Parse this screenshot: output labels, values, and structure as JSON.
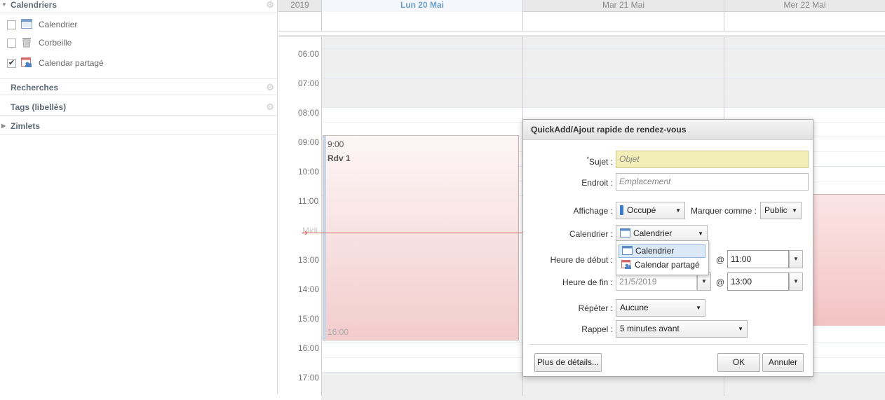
{
  "sidebar": {
    "calendars_header": "Calendriers",
    "calendars": [
      {
        "label": "Calendrier",
        "checked": false,
        "icon": "calendar-icon"
      },
      {
        "label": "Corbeille",
        "checked": false,
        "icon": "trash-icon"
      },
      {
        "label": "Calendar partagé",
        "checked": true,
        "icon": "shared-calendar-icon"
      }
    ],
    "searches_header": "Recherches",
    "tags_header": "Tags (libellés)",
    "zimlets_header": "Zimlets"
  },
  "calendar": {
    "year": "2019",
    "days": [
      "Lun 20 Mai",
      "Mar 21 Mai",
      "Mer 22 Mai"
    ],
    "hours": [
      "06:00",
      "07:00",
      "08:00",
      "09:00",
      "10:00",
      "11:00",
      "Midi",
      "13:00",
      "14:00",
      "15:00",
      "16:00",
      "17:00"
    ],
    "appointment": {
      "start": "9:00",
      "title": "Rdv 1",
      "end": "16:00"
    }
  },
  "dialog": {
    "title": "QuickAdd/Ajout rapide de rendez-vous",
    "subject_label": "Sujet :",
    "subject_required_mark": "*",
    "subject_placeholder": "Objet",
    "location_label": "Endroit :",
    "location_placeholder": "Emplacement",
    "display_label": "Affichage :",
    "display_value": "Occupé",
    "mark_as_label": "Marquer comme :",
    "mark_as_value": "Public",
    "calendar_label": "Calendrier :",
    "calendar_value": "Calendrier",
    "calendar_options": [
      "Calendrier",
      "Calendar partagé"
    ],
    "start_label": "Heure de début :",
    "start_time": "11:00",
    "end_label": "Heure de fin :",
    "end_date": "21/5/2019",
    "end_time": "13:00",
    "at_symbol": "@",
    "repeat_label": "Répéter :",
    "repeat_value": "Aucune",
    "reminder_label": "Rappel :",
    "reminder_value": "5 minutes avant",
    "more_details": "Plus de détails...",
    "ok": "OK",
    "cancel": "Annuler"
  },
  "colors": {
    "accent": "#6d9fc9",
    "busy_swatch": "#3c7bcf",
    "appointment_bg": "#f3cccc",
    "required_field": "#f1eeb8"
  }
}
